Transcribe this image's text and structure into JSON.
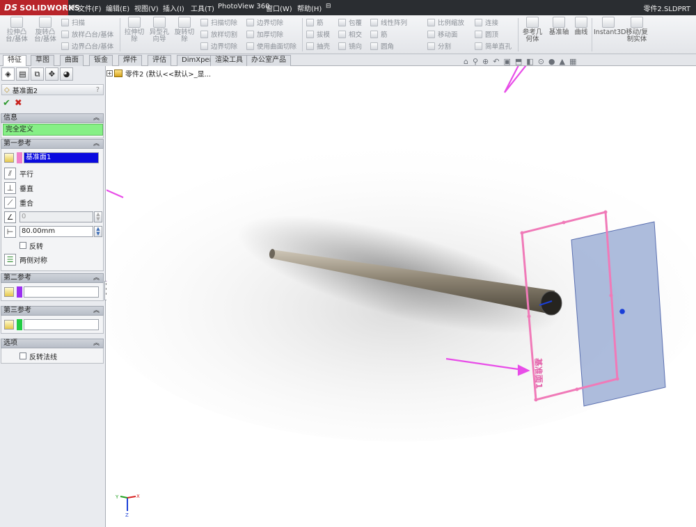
{
  "app": {
    "logo_text": "SOLIDWORKS",
    "logo_prefix": "DS",
    "document_title": "零件2.SLDPRT"
  },
  "menu": [
    "文件(F)",
    "编辑(E)",
    "视图(V)",
    "插入(I)",
    "工具(T)",
    "PhotoView 360",
    "窗口(W)",
    "帮助(H)"
  ],
  "commands": {
    "extrude_boss": "拉伸凸台/基体",
    "revolve_boss": "旋转凸台/基体",
    "sweep": "扫描",
    "loft_boss": "放样凸台/基体",
    "boundary_boss": "边界凸台/基体",
    "extrude_cut": "拉伸切除",
    "hole_wizard": "异型孔向导",
    "revolve_cut": "旋转切除",
    "swept_cut": "扫描切除",
    "lofted_cut": "放样切割",
    "boundary_cut": "边界切除",
    "boundary_cut2": "边界切除",
    "thicken_cut": "加厚切除",
    "surface_cut": "使用曲面切除",
    "rib": "筋",
    "draft": "拔模",
    "shell": "抽壳",
    "wrap": "包覆",
    "intersect": "相交",
    "mirror": "镜向",
    "linear_pattern": "线性阵列",
    "rib2": "筋",
    "fillet": "圆角",
    "scale": "比例缩放",
    "move_face": "移动面",
    "split": "分割",
    "connect": "连接",
    "dome": "圆顶",
    "simple_hole": "简单直孔",
    "ref_geometry": "参考几何体",
    "base_axis": "基准轴",
    "curves": "曲线",
    "instant3d": "Instant3D",
    "move_copy": "移动/复制实体"
  },
  "tabs": [
    "特征",
    "草图",
    "曲面",
    "钣金",
    "焊件",
    "评估",
    "DimXpert",
    "渲染工具",
    "办公室产品"
  ],
  "property_manager": {
    "title": "基准面2",
    "help": "?",
    "info_section": "信息",
    "status": "完全定义",
    "first_ref_section": "第一参考",
    "first_ref_value": "基准面1",
    "parallel": "平行",
    "perpendicular": "垂直",
    "coincident": "重合",
    "angle_value": "0",
    "distance_value": "80.00mm",
    "flip": "反转",
    "mid_plane": "两侧对称",
    "second_ref_section": "第二参考",
    "third_ref_section": "第三参考",
    "options_section": "选项",
    "flip_normal": "反转法线"
  },
  "tree": {
    "label": "零件2  (默认<<默认>_显..."
  },
  "graphics": {
    "plane_label": "基准面1",
    "triad_x": "X",
    "triad_y": "Y",
    "triad_z": "Z"
  },
  "colors": {
    "menubar": "#2a2d31",
    "logo": "#b8242a",
    "annotation_arrow": "#e84de8",
    "preview_plane": "#f07ab8",
    "ref_plane_fill": "#9fb0d6",
    "status_green": "#86f086",
    "first_ref_swatch": "#f080c8",
    "second_ref_swatch": "#9a2ff0",
    "third_ref_swatch": "#22cc44"
  }
}
